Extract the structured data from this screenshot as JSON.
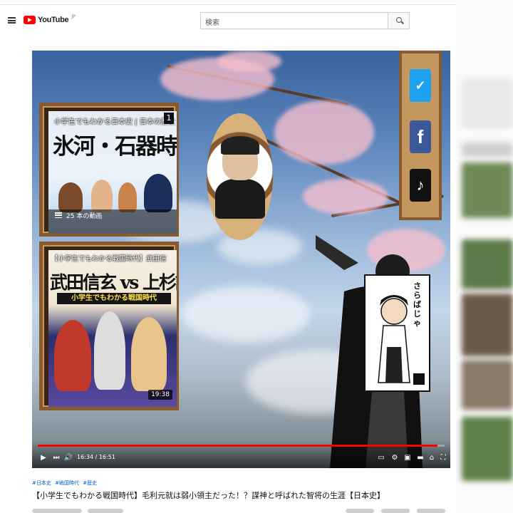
{
  "header": {
    "logo_text": "YouTube",
    "logo_country": "JP",
    "search_placeholder": "検索"
  },
  "player": {
    "playlist_card": {
      "subtitle": "小学生でもわかる日本史 | 日本の歴史",
      "title": "氷河・石器時代",
      "episode_number": "1",
      "video_count": "25 本の動画"
    },
    "video_card": {
      "subtitle": "【小学生でもわかる戦国時代】武田信",
      "title": "武田信玄 vs 上杉謙信",
      "banner": "小学生でもわかる戦国時代",
      "duration": "19:38"
    },
    "manga_caption": "さらばじゃ",
    "social_icons": [
      "twitter-icon",
      "facebook-icon",
      "tiktok-icon"
    ],
    "current_time": "16:34",
    "time_separator": " / ",
    "total_time": "16:51",
    "progress_fraction": 0.983
  },
  "video": {
    "hashtags": [
      "#日本史",
      "#戦国時代",
      "#歴史"
    ],
    "title": "【小学生でもわかる戦国時代】毛利元就は弱小領主だった！？謀神と呼ばれた智将の生涯【日本史】"
  },
  "colors": {
    "brand_red": "#ff0000",
    "link_blue": "#065fd4",
    "wood": "#8a5a2f"
  }
}
